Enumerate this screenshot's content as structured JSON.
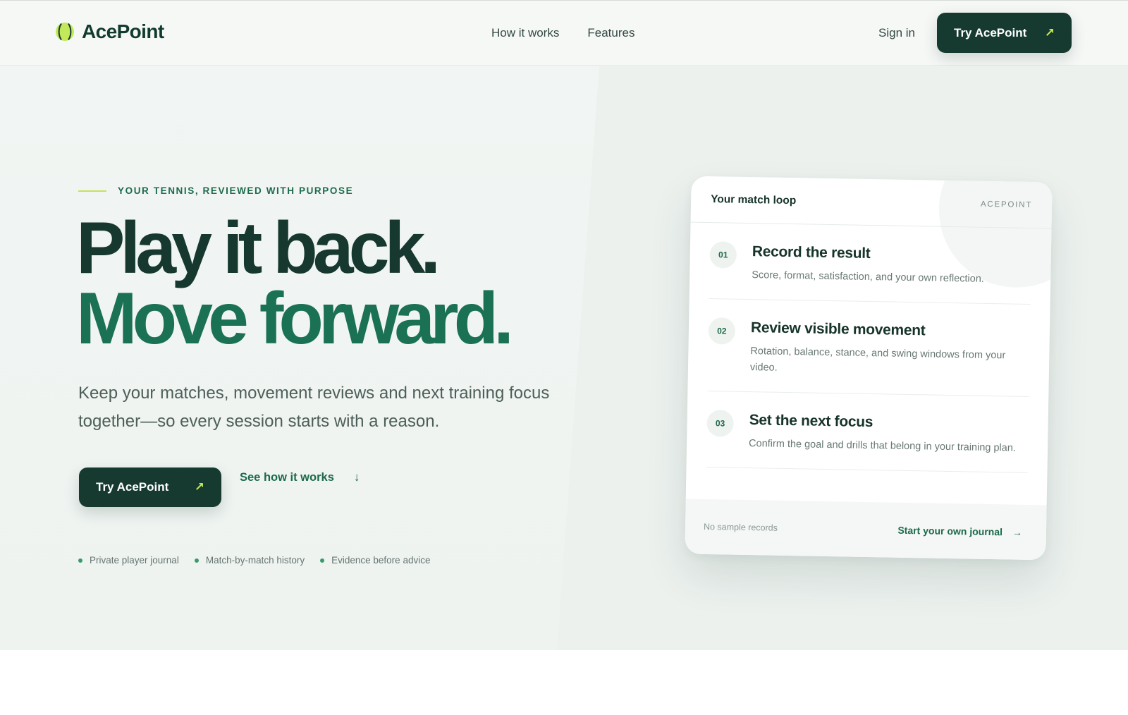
{
  "brand": {
    "name": "AcePoint",
    "logo_icon": "tennis-ball-icon",
    "accent": "#c3e85a",
    "primary": "#163a30"
  },
  "nav": {
    "items": [
      "How it works",
      "Features"
    ],
    "sign_in": "Sign in",
    "cta": "Try AcePoint",
    "cta_icon": "arrow-up-right-icon"
  },
  "hero": {
    "eyebrow": "YOUR TENNIS, REVIEWED WITH PURPOSE",
    "headline_line1": "Play it back.",
    "headline_line2": "Move forward.",
    "lead": "Keep your matches, movement reviews and next training focus together—so every session starts with a reason.",
    "primary_cta": "Try AcePoint",
    "secondary_cta": "See how it works",
    "secondary_icon": "arrow-down-icon",
    "checks": [
      "Private player journal",
      "Match-by-match history",
      "Evidence before advice"
    ]
  },
  "card": {
    "title": "Your match loop",
    "brand": "ACEPOINT",
    "steps": [
      {
        "num": "01",
        "title": "Record the result",
        "desc": "Score, format, satisfaction, and your own reflection."
      },
      {
        "num": "02",
        "title": "Review visible movement",
        "desc": "Rotation, balance, stance, and swing windows from your video."
      },
      {
        "num": "03",
        "title": "Set the next focus",
        "desc": "Confirm the goal and drills that belong in your training plan."
      }
    ],
    "footer_note": "No sample records",
    "footer_link": "Start your own journal",
    "footer_icon": "arrow-right-icon"
  }
}
